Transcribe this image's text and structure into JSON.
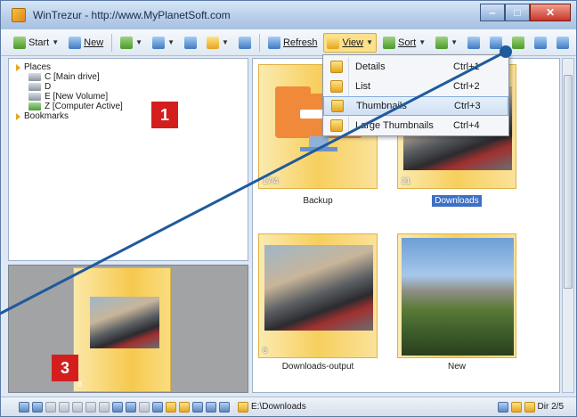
{
  "window": {
    "title": "WinTrezur - http://www.MyPlanetSoft.com"
  },
  "toolbar": {
    "start": "Start",
    "new": "New",
    "refresh": "Refresh",
    "view": "View",
    "sort": "Sort"
  },
  "tree": [
    {
      "label": "Places",
      "level": 0,
      "icon": "triangle-icon"
    },
    {
      "label": "C [Main drive]",
      "level": 1,
      "icon": "drive-icon"
    },
    {
      "label": "D",
      "level": 1,
      "icon": "drive-icon"
    },
    {
      "label": "E [New Volume]",
      "level": 1,
      "icon": "drive-icon"
    },
    {
      "label": "Z [Computer Active]",
      "level": 1,
      "icon": "network-drive-icon"
    },
    {
      "label": "Bookmarks",
      "level": 0,
      "icon": "triangle-icon"
    }
  ],
  "menu": {
    "items": [
      {
        "label": "Details",
        "shortcut": "Ctrl+1"
      },
      {
        "label": "List",
        "shortcut": "Ctrl+2"
      },
      {
        "label": "Thumbnails",
        "shortcut": "Ctrl+3",
        "highlighted": true
      },
      {
        "label": "Large Thumbnails",
        "shortcut": "Ctrl+4"
      }
    ]
  },
  "thumbnails": [
    {
      "name": "Backup",
      "count": "17/4",
      "selected": false
    },
    {
      "name": "Downloads",
      "count": "21",
      "selected": true
    },
    {
      "name": "Downloads-output",
      "count": "6",
      "selected": false
    },
    {
      "name": "New",
      "count": "",
      "selected": false
    }
  ],
  "preview": {
    "count": "8"
  },
  "callouts": {
    "one": "1",
    "three": "3"
  },
  "status": {
    "path": "E:\\Downloads",
    "dir": "Dir 2/5"
  },
  "colors": {
    "accent": "#f6c94e",
    "highlight": "#3d6fc5",
    "callout": "#d41e1e",
    "line": "#1f5a9c"
  }
}
